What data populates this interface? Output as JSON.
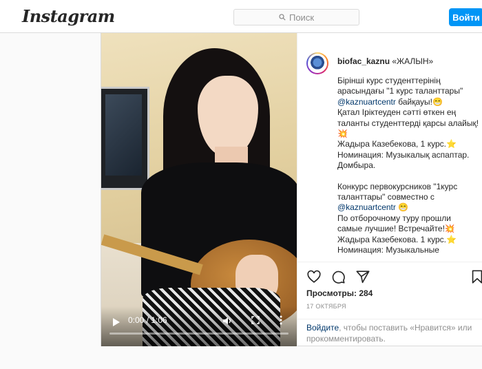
{
  "header": {
    "logo": "Instagram",
    "search_placeholder": "Поиск",
    "login_label": "Войти"
  },
  "video": {
    "time": "0:00 / 1:06",
    "progress": 0.0
  },
  "post": {
    "username": "biofac_kaznu",
    "location_tag": "«ЖАЛЫН»",
    "caption": {
      "l1": "Бірінші курс студенттерінің",
      "l2": "арасындағы \"1 курс таланттары\"",
      "l3_mention": "@kaznuartcentr",
      "l3_rest": " байқауы!😁",
      "l4": "Қатал Іріктеуден сәтті өткен ең",
      "l5": "таланты студенттерді қарсы алайық!",
      "l6": "💥",
      "l7": "Жадыра Казебекова, 1 курс.⭐",
      "l8": "Номинация: Музыкалық аспаптар.",
      "l9": "Домбыра.",
      "l10": "Конкурс первокурсников \"1курс",
      "l11": "таланттары\" совместно с",
      "l12_mention": "@kaznuartcentr",
      "l12_rest": " 😁",
      "l13": "По отборочному туру прошли",
      "l14": "самые лучшие! Встречайте!💥",
      "l15": "Жадыра Казебекова. 1 курс.⭐",
      "l16": "Номинация: Музыкальные"
    },
    "views_label": "Просмотры: 284",
    "date": "17 ОКТЯБРЯ",
    "login_note": {
      "link": "Войдите",
      "rest": ", чтобы поставить «Нравится» или прокомментировать."
    }
  }
}
